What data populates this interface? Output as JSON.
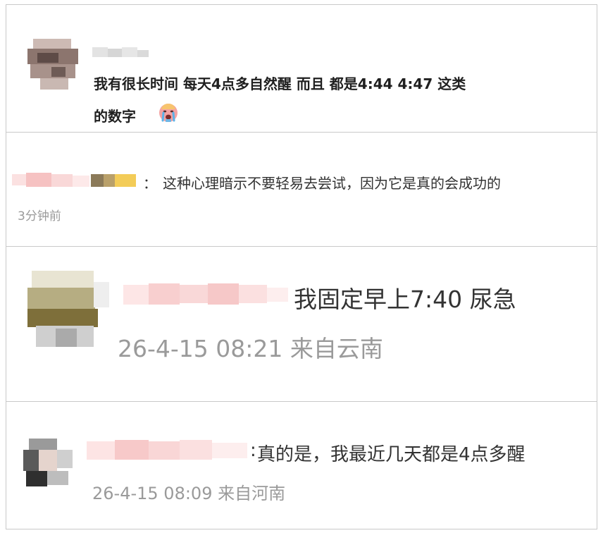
{
  "comments": [
    {
      "text_line1": "我有很长时间 每天4点多自然醒 而且 都是4:44 4:47 这类",
      "text_line2": "的数字",
      "emoji_icon": "crying-face-icon"
    },
    {
      "separator": "：",
      "text": "这种心理暗示不要轻易去尝试，因为它是真的会成功的",
      "time": "3分钟前"
    },
    {
      "text": "我固定早上7:40 尿急",
      "meta": "26-4-15 08:21 来自云南"
    },
    {
      "separator": ":",
      "text": "真的是，我最近几天都是4点多醒",
      "meta": "26-4-15 08:09 来自河南"
    }
  ],
  "colors": {
    "border": "#c9c9c9",
    "text": "#222222",
    "meta": "#9a9a9a",
    "name_blur_pink": "#f6c8c8"
  }
}
